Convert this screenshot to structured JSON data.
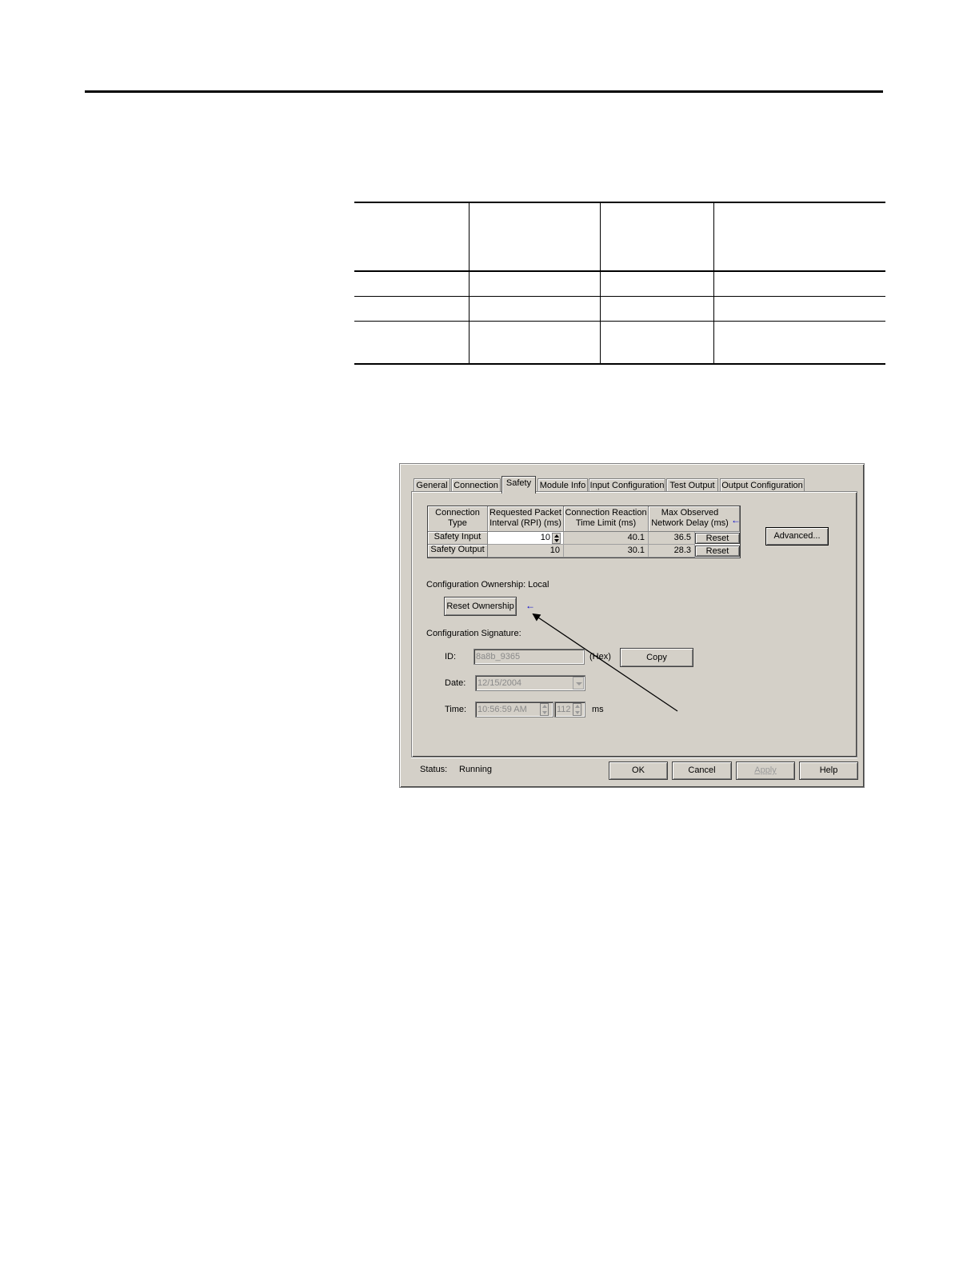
{
  "dialog": {
    "tabs": [
      "General",
      "Connection",
      "Safety",
      "Module Info",
      "Input Configuration",
      "Test Output",
      "Output Configuration"
    ],
    "active_tab": "Safety",
    "grid": {
      "headers": [
        {
          "line1": "Connection",
          "line2": "Type"
        },
        {
          "line1": "Requested Packet",
          "line2": "Interval (RPI) (ms)"
        },
        {
          "line1": "Connection Reaction",
          "line2": "Time Limit (ms)"
        },
        {
          "line1": "Max Observed",
          "line2": "Network Delay (ms)"
        }
      ],
      "rows": [
        {
          "type": "Safety Input",
          "rpi": "10",
          "limit": "40.1",
          "delay": "36.5",
          "reset": "Reset"
        },
        {
          "type": "Safety Output",
          "rpi": "10",
          "limit": "30.1",
          "delay": "28.3",
          "reset": "Reset"
        }
      ]
    },
    "advanced_button": "Advanced...",
    "ownership_label": "Configuration Ownership: Local",
    "reset_ownership_button": "Reset Ownership",
    "signature_label": "Configuration Signature:",
    "id_label": "ID:",
    "id_value": "8a8b_9365",
    "hex_label": "(Hex)",
    "copy_button": "Copy",
    "date_label": "Date:",
    "date_value": "12/15/2004",
    "time_label": "Time:",
    "time_value": "10:56:59 AM",
    "ms_value": "112",
    "ms_label": "ms",
    "status_label": "Status:",
    "status_value": "Running",
    "ok_button": "OK",
    "cancel_button": "Cancel",
    "apply_button": "Apply",
    "help_button": "Help"
  },
  "icons": {
    "indicator": "blue-left-arrow-icon",
    "callout": "callout-arrow"
  }
}
